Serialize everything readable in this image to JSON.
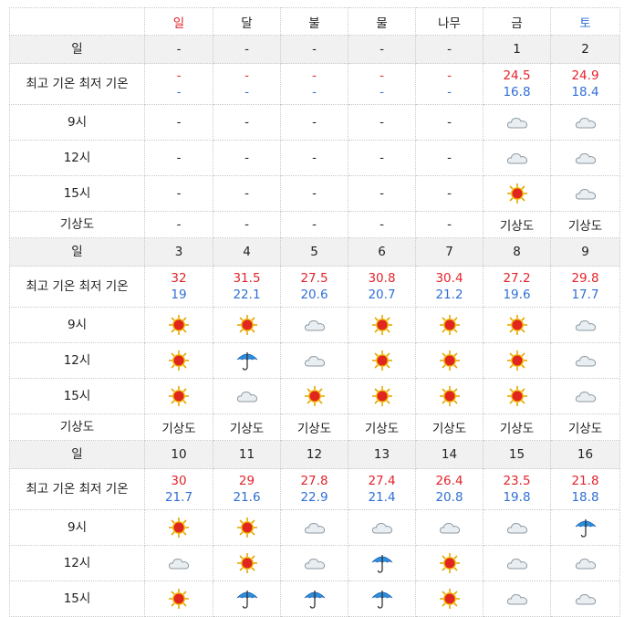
{
  "header": {
    "corner": "",
    "days": [
      "일",
      "달",
      "불",
      "물",
      "나무",
      "금",
      "토"
    ]
  },
  "labels": {
    "date": "일",
    "temp": "최고 기온 최저 기온",
    "h9": "9시",
    "h12": "12시",
    "h15": "15시",
    "satellite": "기상도"
  },
  "dash": "-",
  "weeks": [
    {
      "dates": [
        "-",
        "-",
        "-",
        "-",
        "-",
        "1",
        "2"
      ],
      "hi": [
        "-",
        "-",
        "-",
        "-",
        "-",
        "24.5",
        "24.9"
      ],
      "lo": [
        "-",
        "-",
        "-",
        "-",
        "-",
        "16.8",
        "18.4"
      ],
      "h9": [
        "-",
        "-",
        "-",
        "-",
        "-",
        "cloud-icon",
        "cloud-icon"
      ],
      "h12": [
        "-",
        "-",
        "-",
        "-",
        "-",
        "cloud-icon",
        "cloud-icon"
      ],
      "h15": [
        "-",
        "-",
        "-",
        "-",
        "-",
        "sun-icon",
        "cloud-icon"
      ],
      "sat": [
        "-",
        "-",
        "-",
        "-",
        "-",
        "기상도",
        "기상도"
      ]
    },
    {
      "dates": [
        "3",
        "4",
        "5",
        "6",
        "7",
        "8",
        "9"
      ],
      "hi": [
        "32",
        "31.5",
        "27.5",
        "30.8",
        "30.4",
        "27.2",
        "29.8"
      ],
      "lo": [
        "19",
        "22.1",
        "20.6",
        "20.7",
        "21.2",
        "19.6",
        "17.7"
      ],
      "h9": [
        "sun-icon",
        "sun-icon",
        "cloud-icon",
        "sun-icon",
        "sun-icon",
        "sun-icon",
        "cloud-icon"
      ],
      "h12": [
        "sun-icon",
        "umbrella-icon",
        "cloud-icon",
        "sun-icon",
        "sun-icon",
        "sun-icon",
        "cloud-icon"
      ],
      "h15": [
        "sun-icon",
        "cloud-icon",
        "sun-icon",
        "sun-icon",
        "sun-icon",
        "sun-icon",
        "cloud-icon"
      ],
      "sat": [
        "기상도",
        "기상도",
        "기상도",
        "기상도",
        "기상도",
        "기상도",
        "기상도"
      ]
    },
    {
      "dates": [
        "10",
        "11",
        "12",
        "13",
        "14",
        "15",
        "16"
      ],
      "hi": [
        "30",
        "29",
        "27.8",
        "27.4",
        "26.4",
        "23.5",
        "21.8"
      ],
      "lo": [
        "21.7",
        "21.6",
        "22.9",
        "21.4",
        "20.8",
        "19.8",
        "18.8"
      ],
      "h9": [
        "sun-icon",
        "sun-icon",
        "cloud-icon",
        "cloud-icon",
        "cloud-icon",
        "cloud-icon",
        "umbrella-icon"
      ],
      "h12": [
        "cloud-icon",
        "sun-icon",
        "cloud-icon",
        "umbrella-icon",
        "sun-icon",
        "cloud-icon",
        "cloud-icon"
      ],
      "h15": [
        "sun-icon",
        "umbrella-icon",
        "umbrella-icon",
        "umbrella-icon",
        "sun-icon",
        "cloud-icon",
        "cloud-icon"
      ]
    }
  ],
  "colors": {
    "high": "#e3242b",
    "low": "#2f6fd6",
    "sunday": "#e3242b",
    "saturday": "#2f6fd6",
    "dateRowBg": "#f1f1f1"
  }
}
